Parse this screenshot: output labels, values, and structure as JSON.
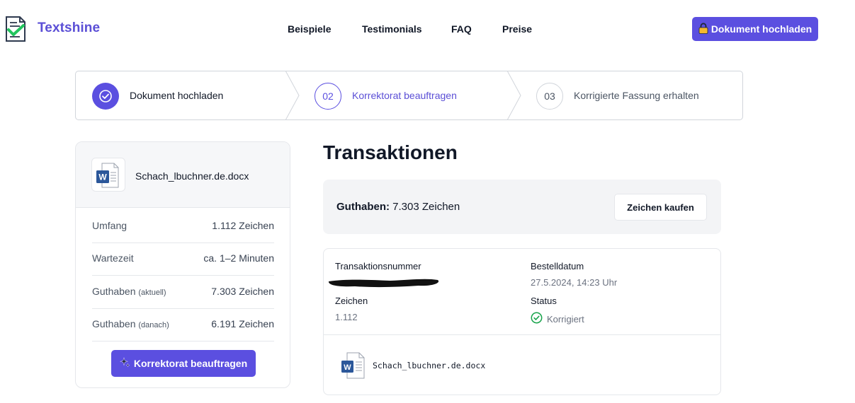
{
  "header": {
    "brand": "Textshine",
    "nav": [
      "Beispiele",
      "Testimonials",
      "FAQ",
      "Preise"
    ],
    "cta_label": "Dokument hochladen"
  },
  "colors": {
    "accent": "#5b4fe0",
    "brand_text": "#5b4fd6",
    "success": "#16a34a"
  },
  "stepper": [
    {
      "number": "",
      "label": "Dokument hochladen",
      "state": "done"
    },
    {
      "number": "02",
      "label": "Korrektorat beauftragen",
      "state": "active"
    },
    {
      "number": "03",
      "label": "Korrigierte Fassung erhalten",
      "state": "pending"
    }
  ],
  "summary": {
    "file_name": "Schach_lbuchner.de.docx",
    "rows": [
      {
        "key": "Umfang",
        "note": "",
        "value": "1.112 Zeichen"
      },
      {
        "key": "Wartezeit",
        "note": "",
        "value": "ca. 1–2 Minuten"
      },
      {
        "key": "Guthaben",
        "note": "(aktuell)",
        "value": "7.303 Zeichen"
      },
      {
        "key": "Guthaben",
        "note": "(danach)",
        "value": "6.191 Zeichen"
      }
    ],
    "button_label": "Korrektorat beauftragen"
  },
  "transactions": {
    "title": "Transaktionen",
    "balance_label": "Guthaben:",
    "balance_value": "7.303 Zeichen",
    "buy_label": "Zeichen kaufen",
    "item": {
      "number_label": "Transaktionsnummer",
      "date_label": "Bestelldatum",
      "date_value": "27.5.2024, 14:23 Uhr",
      "chars_label": "Zeichen",
      "chars_value": "1.112",
      "status_label": "Status",
      "status_value": "Korrigiert",
      "file_name": "Schach_lbuchner.de.docx"
    }
  }
}
